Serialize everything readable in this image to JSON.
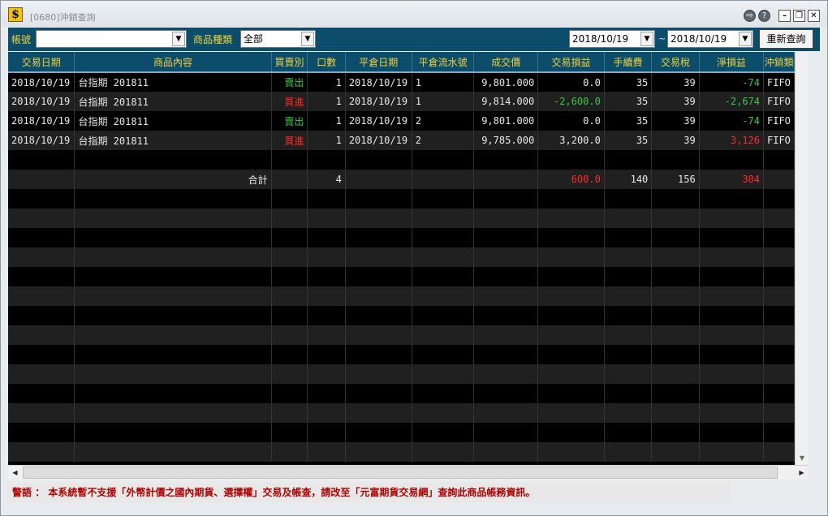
{
  "window": {
    "title": "[0680]沖銷查詢",
    "app_icon_glyph": "$",
    "buttons": {
      "share": "⇨",
      "help": "?",
      "minimize": "–",
      "restore": "❐",
      "close": "✕"
    }
  },
  "toolbar": {
    "account_label": "帳號",
    "account_value": "",
    "product_type_label": "商品種類",
    "product_type_value": "全部",
    "date_from": "2018/10/19",
    "date_separator": "~",
    "date_to": "2018/10/19",
    "requery_label": "重新查詢",
    "dropdown_arrow": "▼"
  },
  "table": {
    "headers": [
      "交易日期",
      "商品內容",
      "買賣別",
      "口數",
      "平倉日期",
      "平倉流水號",
      "成交價",
      "交易損益",
      "手續費",
      "交易稅",
      "淨損益",
      "沖銷類"
    ],
    "rows": [
      {
        "trade_date": "2018/10/19",
        "product": "台指期 201811",
        "side": "賣出",
        "side_color": "green",
        "lots": "1",
        "close_date": "2018/10/19",
        "close_seq": "1",
        "price": "9,801.000",
        "pnl": "0.0",
        "pnl_color": "white",
        "fee": "35",
        "tax": "39",
        "net": "-74",
        "net_color": "green",
        "method": "FIFO"
      },
      {
        "trade_date": "2018/10/19",
        "product": "台指期 201811",
        "side": "買進",
        "side_color": "red",
        "lots": "1",
        "close_date": "2018/10/19",
        "close_seq": "1",
        "price": "9,814.000",
        "pnl": "-2,600.0",
        "pnl_color": "green",
        "fee": "35",
        "tax": "39",
        "net": "-2,674",
        "net_color": "green",
        "method": "FIFO"
      },
      {
        "trade_date": "2018/10/19",
        "product": "台指期 201811",
        "side": "賣出",
        "side_color": "green",
        "lots": "1",
        "close_date": "2018/10/19",
        "close_seq": "2",
        "price": "9,801.000",
        "pnl": "0.0",
        "pnl_color": "white",
        "fee": "35",
        "tax": "39",
        "net": "-74",
        "net_color": "green",
        "method": "FIFO"
      },
      {
        "trade_date": "2018/10/19",
        "product": "台指期 201811",
        "side": "買進",
        "side_color": "red",
        "lots": "1",
        "close_date": "2018/10/19",
        "close_seq": "2",
        "price": "9,785.000",
        "pnl": "3,200.0",
        "pnl_color": "white",
        "fee": "35",
        "tax": "39",
        "net": "3,126",
        "net_color": "red",
        "method": "FIFO"
      }
    ],
    "total": {
      "label": "合計",
      "lots": "4",
      "pnl": "600.0",
      "fee": "140",
      "tax": "156",
      "net": "304"
    }
  },
  "scroll": {
    "up": "▲",
    "down": "▼",
    "left": "◀",
    "right": "▶"
  },
  "warning": "警語 ： 本系統暫不支援「外幣計價之國內期貨、選擇權」交易及帳查，請改至「元富期貨交易網」查詢此商品帳務資訊。"
}
